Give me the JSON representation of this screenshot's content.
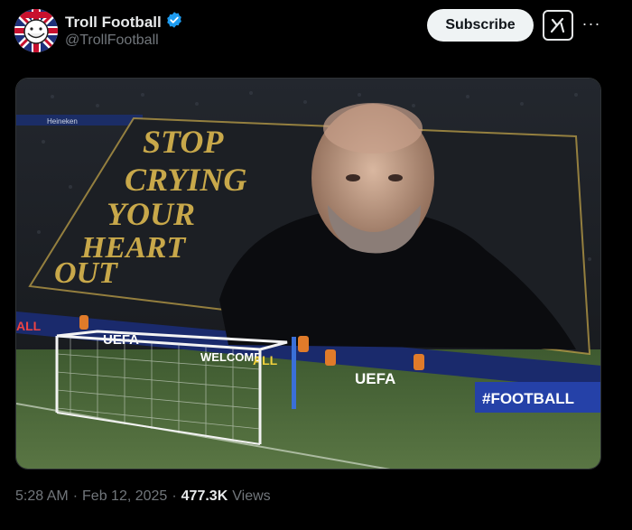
{
  "author": {
    "display_name": "Troll Football",
    "handle": "@TrollFootball",
    "verified_icon": "verified-badge-icon",
    "avatar_icon": "troll-face-union-jack-avatar"
  },
  "actions": {
    "subscribe_label": "Subscribe",
    "grok_icon": "grok-icon",
    "more_icon": "more-dots-icon",
    "more_glyph": "···"
  },
  "media": {
    "banner_lines": [
      "STOP",
      "CRYING",
      "YOUR",
      "HEART",
      "OUT"
    ],
    "board_uefa_1": "UEFA",
    "board_welcome": "WELCOME",
    "board_all": "ALL",
    "board_uefa_2": "UEFA",
    "board_football": "#FOOTBALL",
    "board_left": "ALL",
    "sponsor": "Heineken",
    "colors": {
      "banner_text": "#c8a84a",
      "banner_bg": "#1c1f24",
      "pitch": "#4d6a3a",
      "board": "#1a2a6c"
    }
  },
  "meta": {
    "time": "5:28 AM",
    "separator_1": "·",
    "date": "Feb 12, 2025",
    "separator_2": "·",
    "views_count": "477.3K",
    "views_label": "Views"
  }
}
